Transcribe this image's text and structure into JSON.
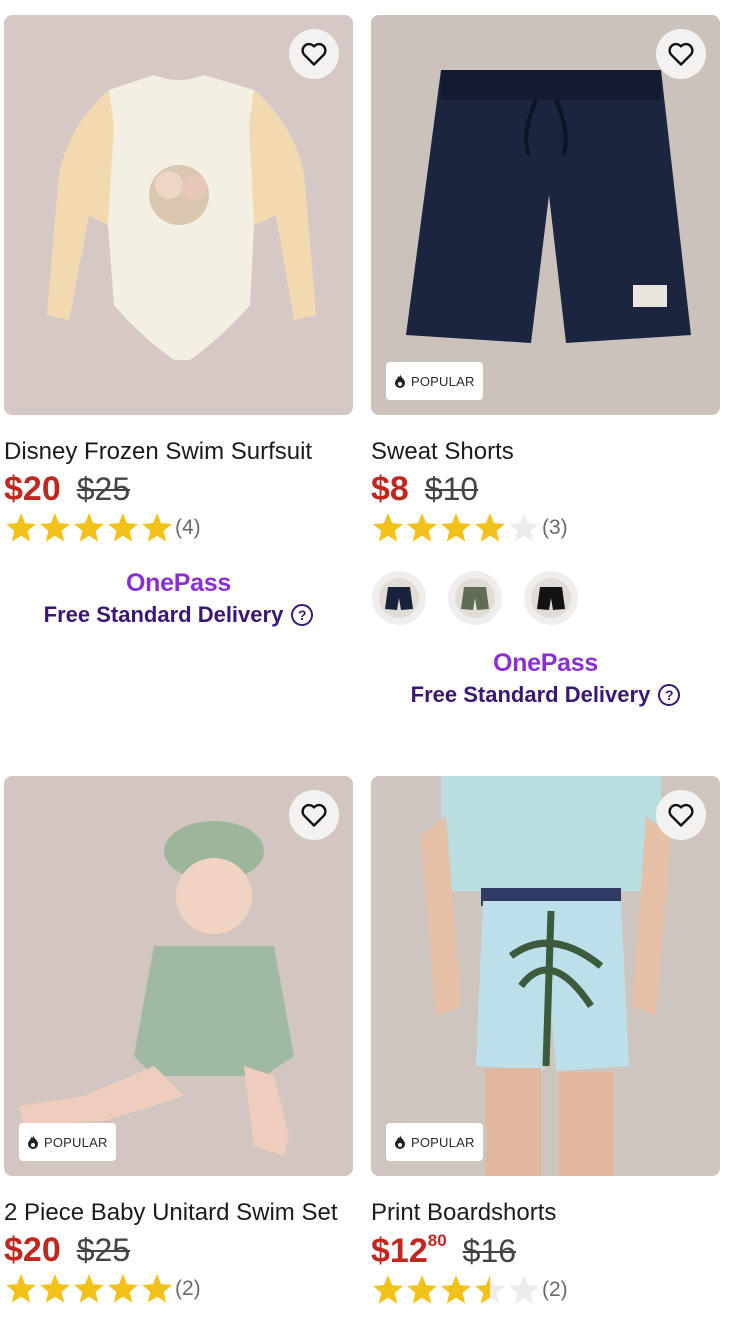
{
  "products": [
    {
      "title": "Disney Frozen Swim Surfsuit",
      "price_now": "$20",
      "price_now_cents": "",
      "price_was": "$25",
      "rating": 5,
      "review_count": "(4)",
      "badge": "",
      "promo_brand": "OnePass",
      "promo_text": "Free Standard Delivery"
    },
    {
      "title": "Sweat Shorts",
      "price_now": "$8",
      "price_now_cents": "",
      "price_was": "$10",
      "rating": 4,
      "review_count": "(3)",
      "badge": "POPULAR",
      "swatch_colors": [
        "#18223a",
        "#5f6d55",
        "#121212"
      ],
      "promo_brand": "OnePass",
      "promo_text": "Free Standard Delivery"
    },
    {
      "title": "2 Piece Baby Unitard Swim Set",
      "price_now": "$20",
      "price_now_cents": "",
      "price_was": "$25",
      "rating": 5,
      "review_count": "(2)",
      "badge": "POPULAR"
    },
    {
      "title": "Print Boardshorts",
      "price_now": "$12",
      "price_now_cents": "80",
      "price_was": "$16",
      "rating": 3.5,
      "review_count": "(2)",
      "badge": "POPULAR"
    }
  ],
  "icons": {
    "wishlist": "heart-outline-icon",
    "badge": "flame-icon",
    "star": "star-icon",
    "help": "question-circle-icon"
  },
  "colors": {
    "sale_price": "#c0281f",
    "star_fill": "#f2c21b",
    "onepass": "#8a2fd4",
    "delivery_text": "#3a1776"
  }
}
